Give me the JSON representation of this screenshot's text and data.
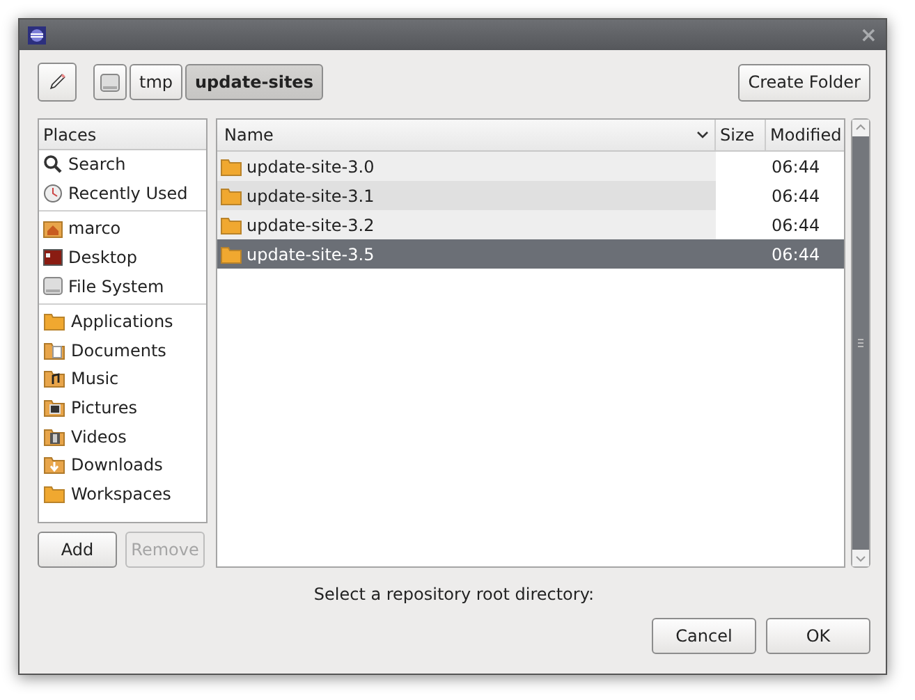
{
  "window": {
    "close_glyph": "×"
  },
  "path_bar": [
    {
      "kind": "drive",
      "selected": false
    },
    {
      "kind": "text",
      "label": "tmp",
      "selected": false
    },
    {
      "kind": "text",
      "label": "update-sites",
      "selected": true
    }
  ],
  "create_folder_button": "Create Folder",
  "places": {
    "header": "Places",
    "groups": [
      [
        {
          "label": "Search",
          "kind": "search"
        },
        {
          "label": "Recently Used",
          "kind": "clock"
        }
      ],
      [
        {
          "label": "marco",
          "kind": "home"
        },
        {
          "label": "Desktop",
          "kind": "desktop"
        },
        {
          "label": "File System",
          "kind": "drive"
        }
      ],
      [
        {
          "label": "Applications",
          "kind": "folder"
        },
        {
          "label": "Documents",
          "kind": "documents"
        },
        {
          "label": "Music",
          "kind": "music"
        },
        {
          "label": "Pictures",
          "kind": "pictures"
        },
        {
          "label": "Videos",
          "kind": "videos"
        },
        {
          "label": "Downloads",
          "kind": "downloads"
        },
        {
          "label": "Workspaces",
          "kind": "folder"
        }
      ]
    ],
    "buttons": [
      {
        "label": "Add",
        "disabled": false
      },
      {
        "label": "Remove",
        "disabled": true
      }
    ]
  },
  "files": {
    "columns": [
      "Name",
      "Size",
      "Modified"
    ],
    "rows": [
      {
        "name": "update-site-3.0",
        "modified": "06:44",
        "selected": false
      },
      {
        "name": "update-site-3.1",
        "modified": "06:44",
        "selected": false
      },
      {
        "name": "update-site-3.2",
        "modified": "06:44",
        "selected": false
      },
      {
        "name": "update-site-3.5",
        "modified": "06:44",
        "selected": true
      }
    ]
  },
  "prompt": "Select a repository root directory:",
  "dialog_buttons": [
    "Cancel",
    "OK"
  ]
}
